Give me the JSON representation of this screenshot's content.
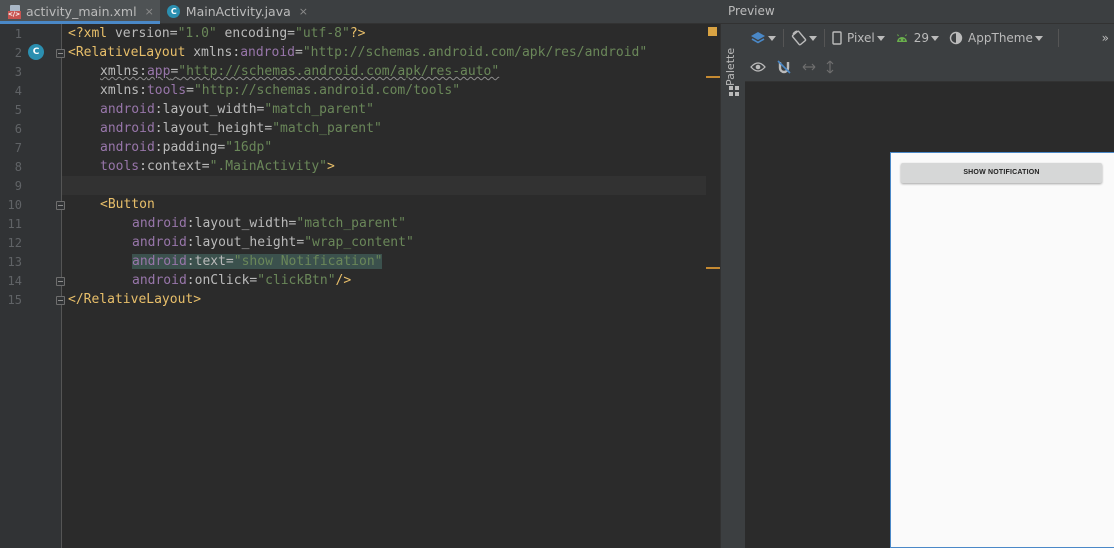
{
  "editor_tabs": [
    {
      "label": "activity_main.xml",
      "icon": "xml-file-icon",
      "active": true,
      "close": "×"
    },
    {
      "label": "MainActivity.java",
      "icon": "java-class-icon",
      "active": false,
      "close": "×"
    }
  ],
  "gutter": {
    "line_numbers": [
      "1",
      "2",
      "3",
      "4",
      "5",
      "6",
      "7",
      "8",
      "9",
      "10",
      "11",
      "12",
      "13",
      "14",
      "15"
    ],
    "class_marker": "C"
  },
  "code": {
    "line1": {
      "open": "<?",
      "xml": "xml",
      "version_attr": " version=",
      "version_val": "\"1.0\"",
      "encoding_attr": " encoding=",
      "encoding_val": "\"utf-8\"",
      "close": "?>"
    },
    "line2": {
      "tag": "<RelativeLayout",
      "attr": " xmlns:",
      "ns": "android",
      "eq": "=",
      "val": "\"http://schemas.android.com/apk/res/android\""
    },
    "line3": {
      "attr": "xmlns:",
      "ns": "app",
      "eq": "=",
      "val": "\"http://schemas.android.com/apk/res-auto\""
    },
    "line4": {
      "attr": "xmlns:",
      "ns": "tools",
      "eq": "=",
      "val": "\"http://schemas.android.com/tools\""
    },
    "line5": {
      "ns": "android",
      "attr": ":layout_width=",
      "val": "\"match_parent\""
    },
    "line6": {
      "ns": "android",
      "attr": ":layout_height=",
      "val": "\"match_parent\""
    },
    "line7": {
      "ns": "android",
      "attr": ":padding=",
      "val": "\"16dp\""
    },
    "line8": {
      "ns": "tools",
      "attr": ":context=",
      "val": "\".MainActivity\"",
      "close": ">"
    },
    "line10": {
      "tag": "<Button"
    },
    "line11": {
      "ns": "android",
      "attr": ":layout_width=",
      "val": "\"match_parent\""
    },
    "line12": {
      "ns": "android",
      "attr": ":layout_height=",
      "val": "\"wrap_content\""
    },
    "line13": {
      "ns": "android",
      "attr": ":text=",
      "val": "\"show Notification\""
    },
    "line14": {
      "ns": "android",
      "attr": ":onClick=",
      "val": "\"clickBtn\"",
      "close": "/>"
    },
    "line15": {
      "tag": "</RelativeLayout>"
    }
  },
  "palette": {
    "label": "Palette"
  },
  "preview": {
    "title": "Preview",
    "device": "Pixel",
    "api_level": "29",
    "theme": "AppTheme",
    "more": "»",
    "rendered_button": "SHOW NOTIFICATION"
  },
  "colors": {
    "editor_bg": "#2b2b2b",
    "tag": "#e8bf6a",
    "string": "#6a8759",
    "namespace": "#9876aa",
    "accent": "#4a88c7",
    "warning_marker": "#d9a343"
  }
}
